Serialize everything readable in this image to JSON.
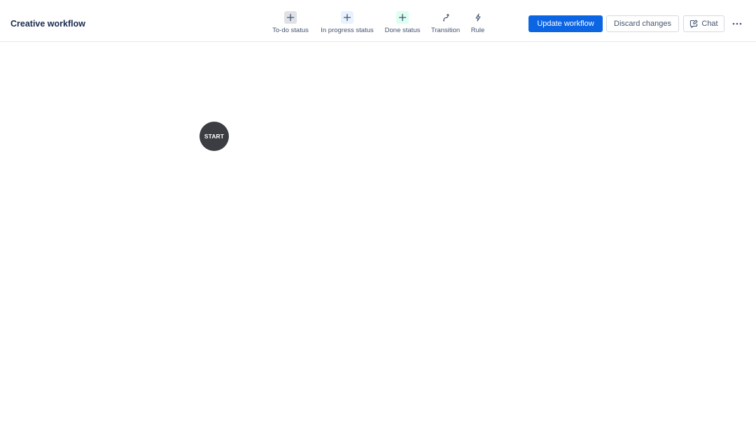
{
  "header": {
    "title": "Creative workflow"
  },
  "toolbar": {
    "tools": [
      {
        "label": "To-do status",
        "icon": "plus-icon",
        "color": "#dfe1e6"
      },
      {
        "label": "In progress status",
        "icon": "plus-icon",
        "color": "#e9f2ff"
      },
      {
        "label": "Done status",
        "icon": "plus-icon",
        "color": "#dcfff1"
      },
      {
        "label": "Transition",
        "icon": "transition-arrow-icon"
      },
      {
        "label": "Rule",
        "icon": "lightning-bolt-icon"
      }
    ]
  },
  "actions": {
    "update_label": "Update workflow",
    "discard_label": "Discard changes",
    "chat_label": "Chat",
    "more_icon": "more-horizontal-icon"
  },
  "canvas": {
    "start_label": "START"
  },
  "colors": {
    "primary": "#0c66e4",
    "start_node": "#3b3d42"
  }
}
